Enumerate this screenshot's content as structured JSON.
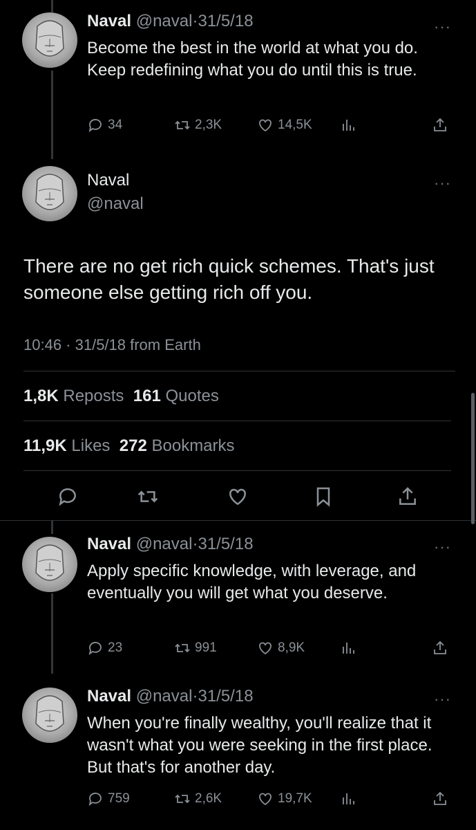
{
  "tweets": [
    {
      "name": "Naval",
      "handle": "@naval",
      "sep": "·",
      "date": "31/5/18",
      "more": "···",
      "text": "Become the best in the world at what you do. Keep redefining what you do until this is true.",
      "replies": "34",
      "reposts": "2,3K",
      "likes": "14,5K"
    },
    {
      "name": "Naval",
      "handle": "@naval",
      "sep": "·",
      "date": "31/5/18",
      "more": "···",
      "text": "Apply specific knowledge, with leverage, and eventually you will get what you deserve.",
      "replies": "23",
      "reposts": "991",
      "likes": "8,9K"
    },
    {
      "name": "Naval",
      "handle": "@naval",
      "sep": "·",
      "date": "31/5/18",
      "more": "···",
      "text": "When you're finally wealthy, you'll realize that it wasn't what you were seeking in the first place. But that's for another day.",
      "replies": "759",
      "reposts": "2,6K",
      "likes": "19,7K"
    }
  ],
  "focused": {
    "name": "Naval",
    "handle": "@naval",
    "more": "···",
    "text": "There are no get rich quick schemes. That's just someone else getting rich off you.",
    "timestamp": "10:46 · 31/5/18 from Earth",
    "reposts_count": "1,8K",
    "reposts_label": "Reposts",
    "quotes_count": "161",
    "quotes_label": "Quotes",
    "likes_count": "11,9K",
    "likes_label": "Likes",
    "bookmarks_count": "272",
    "bookmarks_label": "Bookmarks"
  },
  "icons": {
    "reply": "reply-icon",
    "repost": "repost-icon",
    "like": "heart-icon",
    "views": "views-icon",
    "share": "share-icon",
    "bookmark": "bookmark-icon",
    "more": "more-icon"
  },
  "colors": {
    "background": "#000000",
    "text": "#e7e9ea",
    "secondary": "#8b9197",
    "divider": "#2f3336"
  }
}
